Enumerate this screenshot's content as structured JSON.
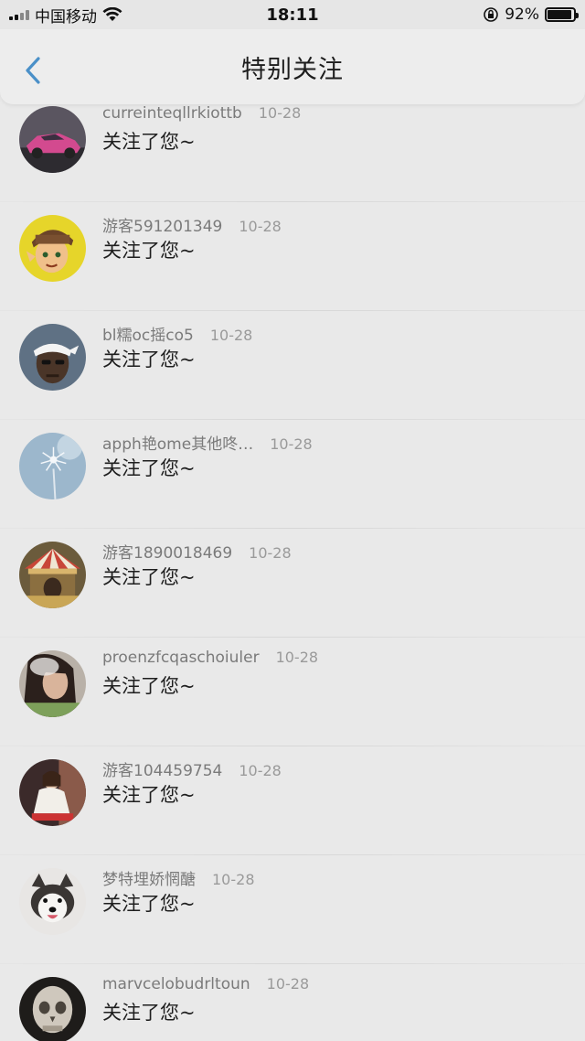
{
  "status_bar": {
    "carrier": "中国移动",
    "time": "18:11",
    "battery": "92%"
  },
  "header": {
    "title": "特别关注"
  },
  "notifications": [
    {
      "username": "curreinteqllrkiottb",
      "date": "10-28",
      "message": "关注了您~",
      "avatar": "pink-sports-car-avatar"
    },
    {
      "username": "游客591201349",
      "date": "10-28",
      "message": "关注了您~",
      "avatar": "cartoon-character-avatar"
    },
    {
      "username": "bl糯oc摇co5",
      "date": "10-28",
      "message": "关注了您~",
      "avatar": "man-with-bandana-avatar"
    },
    {
      "username": "apph艳ome其他咚…",
      "date": "10-28",
      "message": "关注了您~",
      "avatar": "dandelion-sky-avatar"
    },
    {
      "username": "游客1890018469",
      "date": "10-28",
      "message": "关注了您~",
      "avatar": "carousel-avatar"
    },
    {
      "username": "proenzfcqaschoiuler",
      "date": "10-28",
      "message": "关注了您~",
      "avatar": "smoking-girl-avatar"
    },
    {
      "username": "游客104459754",
      "date": "10-28",
      "message": "关注了您~",
      "avatar": "girl-in-white-avatar"
    },
    {
      "username": "梦特埋娇惘醣",
      "date": "10-28",
      "message": "关注了您~",
      "avatar": "husky-dog-avatar"
    },
    {
      "username": "marvcelobudrltoun",
      "date": "10-28",
      "message": "关注了您~",
      "avatar": "skull-sculpture-avatar"
    }
  ]
}
